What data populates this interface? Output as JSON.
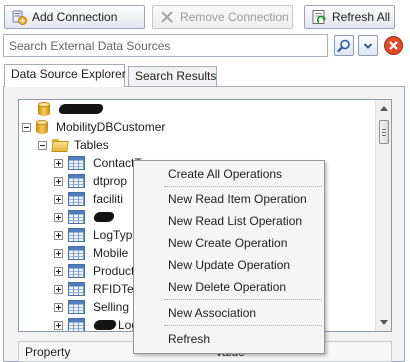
{
  "toolbar": {
    "add_connection": "Add Connection",
    "remove_connection": "Remove Connection",
    "refresh_all": "Refresh All"
  },
  "search": {
    "placeholder": "Search External Data Sources"
  },
  "tabs": [
    {
      "label": "Data Source Explorer",
      "active": true
    },
    {
      "label": "Search Results",
      "active": false
    }
  ],
  "tree": {
    "connection_1": "",
    "connection_2": "MobilityDBCustomer",
    "tables_folder": "Tables",
    "tables": [
      "ContactType",
      "dtprop",
      "faciliti",
      "",
      "LogType",
      "Mobile",
      "Product",
      "RFIDTe",
      "Selling",
      "Log"
    ]
  },
  "properties": {
    "property_header": "Property",
    "value_header": "Value"
  },
  "context_menu": {
    "items": [
      "Create All Operations",
      "New Read Item Operation",
      "New Read List Operation",
      "New Create Operation",
      "New Update Operation",
      "New Delete Operation",
      "New Association",
      "Refresh"
    ]
  },
  "colors": {
    "accent_blue": "#4f7dbd",
    "cancel_red": "#d9452a",
    "menu_background": "#f5f5f5"
  },
  "icons": {
    "add_connection": "add-connection-icon",
    "remove_connection": "remove-x-icon",
    "refresh_all": "refresh-icon",
    "search": "search-icon",
    "dropdown": "chevron-down-icon",
    "cancel": "close-icon"
  }
}
